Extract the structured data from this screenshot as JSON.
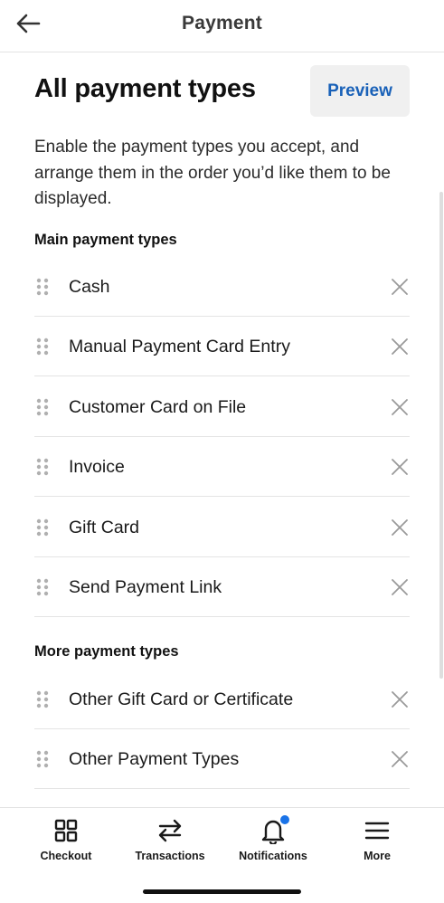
{
  "header": {
    "title": "Payment",
    "back_icon": "arrow-left-icon"
  },
  "intro": {
    "title": "All payment types",
    "preview_label": "Preview",
    "description": "Enable the payment types you accept, and arrange them in the order you’d like them to be displayed."
  },
  "main_section": {
    "title": "Main payment types",
    "items": [
      {
        "label": "Cash"
      },
      {
        "label": "Manual Payment Card Entry"
      },
      {
        "label": "Customer Card on File"
      },
      {
        "label": "Invoice"
      },
      {
        "label": "Gift Card"
      },
      {
        "label": "Send Payment Link"
      }
    ]
  },
  "more_section": {
    "title": "More payment types",
    "items": [
      {
        "label": "Other Gift Card or Certificate"
      },
      {
        "label": "Other Payment Types"
      }
    ]
  },
  "tabbar": {
    "tabs": [
      {
        "label": "Checkout",
        "icon": "grid-icon"
      },
      {
        "label": "Transactions",
        "icon": "swap-arrows-icon"
      },
      {
        "label": "Notifications",
        "icon": "bell-icon"
      },
      {
        "label": "More",
        "icon": "menu-icon"
      }
    ]
  },
  "colors": {
    "accent": "#1961b8",
    "notification_dot": "#1a73e8",
    "divider": "#e4e4e4"
  }
}
